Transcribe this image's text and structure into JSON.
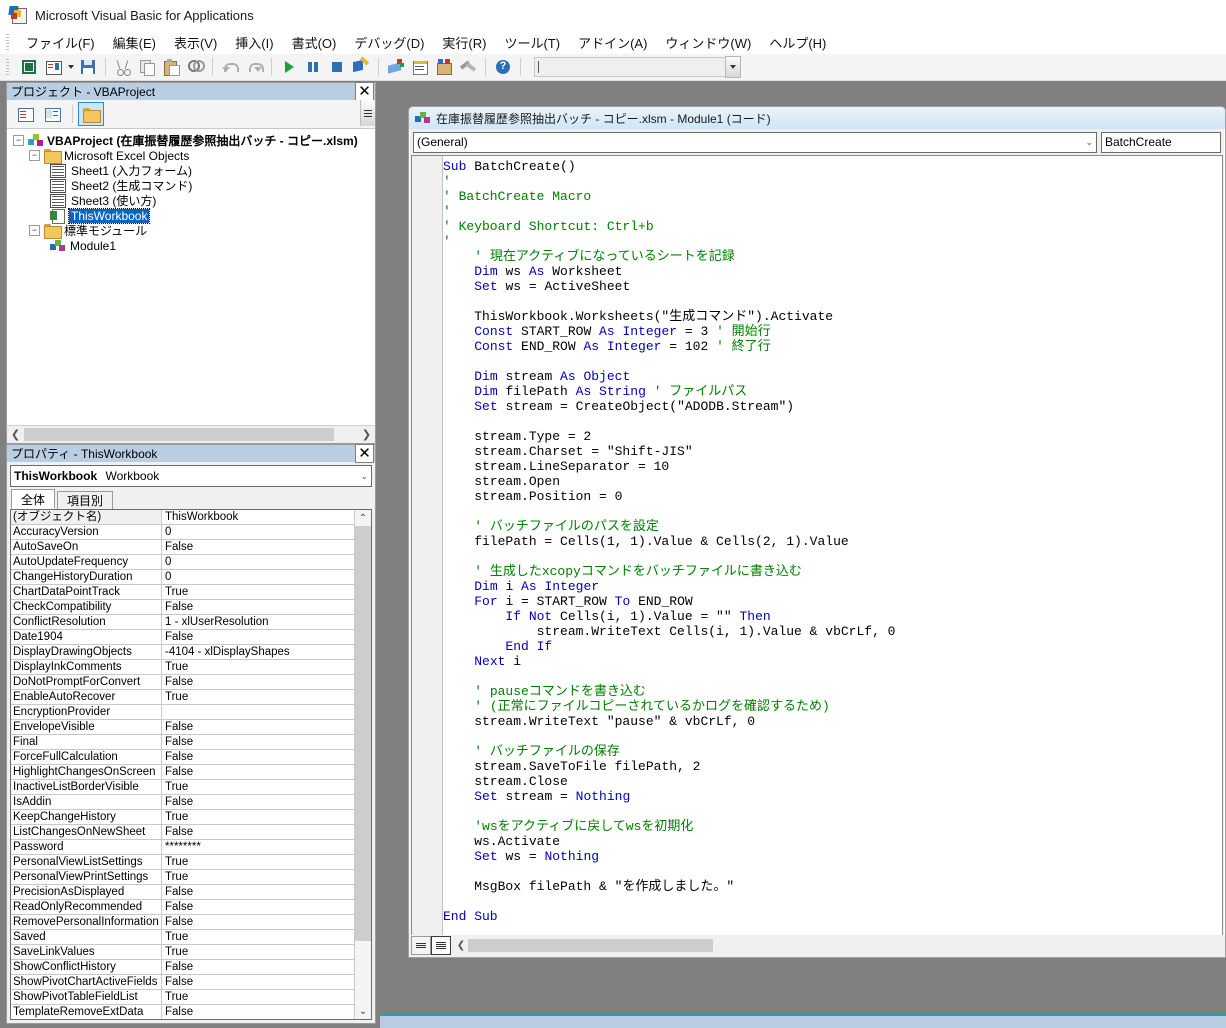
{
  "window": {
    "title": "Microsoft Visual Basic for Applications",
    "app_icon": "vba-icon"
  },
  "menubar": {
    "items": [
      {
        "label": "ファイル(F)",
        "name": "file"
      },
      {
        "label": "編集(E)",
        "name": "edit"
      },
      {
        "label": "表示(V)",
        "name": "view"
      },
      {
        "label": "挿入(I)",
        "name": "insert"
      },
      {
        "label": "書式(O)",
        "name": "format"
      },
      {
        "label": "デバッグ(D)",
        "name": "debug"
      },
      {
        "label": "実行(R)",
        "name": "run"
      },
      {
        "label": "ツール(T)",
        "name": "tools"
      },
      {
        "label": "アドイン(A)",
        "name": "addins"
      },
      {
        "label": "ウィンドウ(W)",
        "name": "window"
      },
      {
        "label": "ヘルプ(H)",
        "name": "help"
      }
    ]
  },
  "toolbar": {
    "buttons": [
      "view-excel-icon",
      "insert-userform-icon",
      "insert-dropdown-icon",
      "save-icon",
      "cut-icon",
      "copy-icon",
      "paste-icon",
      "find-icon",
      "undo-icon",
      "redo-icon",
      "run-icon",
      "break-icon",
      "reset-icon",
      "design-mode-icon",
      "project-explorer-icon",
      "properties-window-icon",
      "object-browser-icon",
      "toolbox-icon",
      "help-icon"
    ],
    "combo_value": "",
    "combo_placeholder": ""
  },
  "project_explorer": {
    "title": "プロジェクト - VBAProject",
    "close_label": "✕",
    "toolbar": [
      {
        "name": "view-code-icon",
        "pressed": false
      },
      {
        "name": "view-object-icon",
        "pressed": false
      },
      {
        "name": "toggle-folders-icon",
        "pressed": true
      }
    ],
    "tree": [
      {
        "label": "VBAProject (在庫振替履歴参照抽出バッチ - コピー.xlsm)",
        "indent": 0,
        "icon": "project-icon",
        "expander": "-",
        "bold": true,
        "selected": false
      },
      {
        "label": "Microsoft Excel Objects",
        "indent": 1,
        "icon": "folder-icon",
        "expander": "-",
        "bold": false,
        "selected": false
      },
      {
        "label": "Sheet1 (入力フォーム)",
        "indent": 2,
        "icon": "sheet-icon",
        "expander": "",
        "bold": false,
        "selected": false
      },
      {
        "label": "Sheet2 (生成コマンド)",
        "indent": 2,
        "icon": "sheet-icon",
        "expander": "",
        "bold": false,
        "selected": false
      },
      {
        "label": "Sheet3 (使い方)",
        "indent": 2,
        "icon": "sheet-icon",
        "expander": "",
        "bold": false,
        "selected": false
      },
      {
        "label": "ThisWorkbook",
        "indent": 2,
        "icon": "workbook-icon",
        "expander": "",
        "bold": false,
        "selected": true
      },
      {
        "label": "標準モジュール",
        "indent": 1,
        "icon": "folder-icon",
        "expander": "-",
        "bold": false,
        "selected": false
      },
      {
        "label": "Module1",
        "indent": 2,
        "icon": "module-icon",
        "expander": "",
        "bold": false,
        "selected": false
      }
    ]
  },
  "properties_panel": {
    "title": "プロパティ - ThisWorkbook",
    "close_label": "✕",
    "object_name": "ThisWorkbook",
    "object_type": "Workbook",
    "tabs": [
      {
        "label": "全体",
        "active": true
      },
      {
        "label": "項目別",
        "active": false
      }
    ],
    "rows": [
      {
        "key": "(オブジェクト名)",
        "value": "ThisWorkbook"
      },
      {
        "key": "AccuracyVersion",
        "value": "0"
      },
      {
        "key": "AutoSaveOn",
        "value": "False"
      },
      {
        "key": "AutoUpdateFrequency",
        "value": "0"
      },
      {
        "key": "ChangeHistoryDuration",
        "value": "0"
      },
      {
        "key": "ChartDataPointTrack",
        "value": "True"
      },
      {
        "key": "CheckCompatibility",
        "value": "False"
      },
      {
        "key": "ConflictResolution",
        "value": "1 - xlUserResolution"
      },
      {
        "key": "Date1904",
        "value": "False"
      },
      {
        "key": "DisplayDrawingObjects",
        "value": "-4104 - xlDisplayShapes"
      },
      {
        "key": "DisplayInkComments",
        "value": "True"
      },
      {
        "key": "DoNotPromptForConvert",
        "value": "False"
      },
      {
        "key": "EnableAutoRecover",
        "value": "True"
      },
      {
        "key": "EncryptionProvider",
        "value": ""
      },
      {
        "key": "EnvelopeVisible",
        "value": "False"
      },
      {
        "key": "Final",
        "value": "False"
      },
      {
        "key": "ForceFullCalculation",
        "value": "False"
      },
      {
        "key": "HighlightChangesOnScreen",
        "value": "False"
      },
      {
        "key": "InactiveListBorderVisible",
        "value": "True"
      },
      {
        "key": "IsAddin",
        "value": "False"
      },
      {
        "key": "KeepChangeHistory",
        "value": "True"
      },
      {
        "key": "ListChangesOnNewSheet",
        "value": "False"
      },
      {
        "key": "Password",
        "value": "********"
      },
      {
        "key": "PersonalViewListSettings",
        "value": "True"
      },
      {
        "key": "PersonalViewPrintSettings",
        "value": "True"
      },
      {
        "key": "PrecisionAsDisplayed",
        "value": "False"
      },
      {
        "key": "ReadOnlyRecommended",
        "value": "False"
      },
      {
        "key": "RemovePersonalInformation",
        "value": "False"
      },
      {
        "key": "Saved",
        "value": "True"
      },
      {
        "key": "SaveLinkValues",
        "value": "True"
      },
      {
        "key": "ShowConflictHistory",
        "value": "False"
      },
      {
        "key": "ShowPivotChartActiveFields",
        "value": "False"
      },
      {
        "key": "ShowPivotTableFieldList",
        "value": "True"
      },
      {
        "key": "TemplateRemoveExtData",
        "value": "False"
      }
    ]
  },
  "code_window": {
    "title": "在庫振替履歴参照抽出バッチ - コピー.xlsm - Module1 (コード)",
    "object_combo": "(General)",
    "procedure_combo": "BatchCreate",
    "view_buttons": [
      {
        "name": "procedure-view-button",
        "active": false
      },
      {
        "name": "full-module-view-button",
        "active": true
      }
    ],
    "code_lines": [
      [
        {
          "t": "Sub ",
          "c": "kw"
        },
        {
          "t": "BatchCreate()",
          "c": "tx"
        }
      ],
      [
        {
          "t": "'",
          "c": "cm"
        }
      ],
      [
        {
          "t": "' BatchCreate Macro",
          "c": "cm"
        }
      ],
      [
        {
          "t": "'",
          "c": "cm"
        }
      ],
      [
        {
          "t": "' Keyboard Shortcut: Ctrl+b",
          "c": "cm"
        }
      ],
      [
        {
          "t": "'",
          "c": "cm"
        }
      ],
      [
        {
          "t": "    ",
          "c": "tx"
        },
        {
          "t": "' 現在アクティブになっているシートを記録",
          "c": "cm"
        }
      ],
      [
        {
          "t": "    ",
          "c": "tx"
        },
        {
          "t": "Dim ",
          "c": "kw"
        },
        {
          "t": "ws ",
          "c": "tx"
        },
        {
          "t": "As ",
          "c": "kw"
        },
        {
          "t": "Worksheet",
          "c": "tx"
        }
      ],
      [
        {
          "t": "    ",
          "c": "tx"
        },
        {
          "t": "Set ",
          "c": "kw"
        },
        {
          "t": "ws = ActiveSheet",
          "c": "tx"
        }
      ],
      [
        {
          "t": "",
          "c": "tx"
        }
      ],
      [
        {
          "t": "    ThisWorkbook.Worksheets(\"生成コマンド\").Activate",
          "c": "tx"
        }
      ],
      [
        {
          "t": "    ",
          "c": "tx"
        },
        {
          "t": "Const ",
          "c": "kw"
        },
        {
          "t": "START_ROW ",
          "c": "tx"
        },
        {
          "t": "As Integer",
          "c": "kw"
        },
        {
          "t": " = 3 ",
          "c": "tx"
        },
        {
          "t": "' 開始行",
          "c": "cm"
        }
      ],
      [
        {
          "t": "    ",
          "c": "tx"
        },
        {
          "t": "Const ",
          "c": "kw"
        },
        {
          "t": "END_ROW ",
          "c": "tx"
        },
        {
          "t": "As Integer",
          "c": "kw"
        },
        {
          "t": " = 102 ",
          "c": "tx"
        },
        {
          "t": "' 終了行",
          "c": "cm"
        }
      ],
      [
        {
          "t": "",
          "c": "tx"
        }
      ],
      [
        {
          "t": "    ",
          "c": "tx"
        },
        {
          "t": "Dim ",
          "c": "kw"
        },
        {
          "t": "stream ",
          "c": "tx"
        },
        {
          "t": "As Object",
          "c": "kw"
        }
      ],
      [
        {
          "t": "    ",
          "c": "tx"
        },
        {
          "t": "Dim ",
          "c": "kw"
        },
        {
          "t": "filePath ",
          "c": "tx"
        },
        {
          "t": "As String",
          "c": "kw"
        },
        {
          "t": " ",
          "c": "tx"
        },
        {
          "t": "' ファイルパス",
          "c": "cm"
        }
      ],
      [
        {
          "t": "    ",
          "c": "tx"
        },
        {
          "t": "Set ",
          "c": "kw"
        },
        {
          "t": "stream = CreateObject(\"ADODB.Stream\")",
          "c": "tx"
        }
      ],
      [
        {
          "t": "",
          "c": "tx"
        }
      ],
      [
        {
          "t": "    stream.Type = 2",
          "c": "tx"
        }
      ],
      [
        {
          "t": "    stream.Charset = \"Shift-JIS\"",
          "c": "tx"
        }
      ],
      [
        {
          "t": "    stream.LineSeparator = 10",
          "c": "tx"
        }
      ],
      [
        {
          "t": "    stream.Open",
          "c": "tx"
        }
      ],
      [
        {
          "t": "    stream.Position = 0",
          "c": "tx"
        }
      ],
      [
        {
          "t": "",
          "c": "tx"
        }
      ],
      [
        {
          "t": "    ",
          "c": "tx"
        },
        {
          "t": "' バッチファイルのパスを設定",
          "c": "cm"
        }
      ],
      [
        {
          "t": "    filePath = Cells(1, 1).Value & Cells(2, 1).Value",
          "c": "tx"
        }
      ],
      [
        {
          "t": "",
          "c": "tx"
        }
      ],
      [
        {
          "t": "    ",
          "c": "tx"
        },
        {
          "t": "' 生成したxcopyコマンドをバッチファイルに書き込む",
          "c": "cm"
        }
      ],
      [
        {
          "t": "    ",
          "c": "tx"
        },
        {
          "t": "Dim ",
          "c": "kw"
        },
        {
          "t": "i ",
          "c": "tx"
        },
        {
          "t": "As Integer",
          "c": "kw"
        }
      ],
      [
        {
          "t": "    ",
          "c": "tx"
        },
        {
          "t": "For ",
          "c": "kw"
        },
        {
          "t": "i = START_ROW ",
          "c": "tx"
        },
        {
          "t": "To ",
          "c": "kw"
        },
        {
          "t": "END_ROW",
          "c": "tx"
        }
      ],
      [
        {
          "t": "        ",
          "c": "tx"
        },
        {
          "t": "If Not ",
          "c": "kw"
        },
        {
          "t": "Cells(i, 1).Value = \"\" ",
          "c": "tx"
        },
        {
          "t": "Then",
          "c": "kw"
        }
      ],
      [
        {
          "t": "            stream.WriteText Cells(i, 1).Value & vbCrLf, 0",
          "c": "tx"
        }
      ],
      [
        {
          "t": "        ",
          "c": "tx"
        },
        {
          "t": "End If",
          "c": "kw"
        }
      ],
      [
        {
          "t": "    ",
          "c": "tx"
        },
        {
          "t": "Next ",
          "c": "kw"
        },
        {
          "t": "i",
          "c": "tx"
        }
      ],
      [
        {
          "t": "",
          "c": "tx"
        }
      ],
      [
        {
          "t": "    ",
          "c": "tx"
        },
        {
          "t": "' pauseコマンドを書き込む",
          "c": "cm"
        }
      ],
      [
        {
          "t": "    ",
          "c": "tx"
        },
        {
          "t": "' (正常にファイルコピーされているかログを確認するため)",
          "c": "cm"
        }
      ],
      [
        {
          "t": "    stream.WriteText \"pause\" & vbCrLf, 0",
          "c": "tx"
        }
      ],
      [
        {
          "t": "",
          "c": "tx"
        }
      ],
      [
        {
          "t": "    ",
          "c": "tx"
        },
        {
          "t": "' バッチファイルの保存",
          "c": "cm"
        }
      ],
      [
        {
          "t": "    stream.SaveToFile filePath, 2",
          "c": "tx"
        }
      ],
      [
        {
          "t": "    stream.Close",
          "c": "tx"
        }
      ],
      [
        {
          "t": "    ",
          "c": "tx"
        },
        {
          "t": "Set ",
          "c": "kw"
        },
        {
          "t": "stream = ",
          "c": "tx"
        },
        {
          "t": "Nothing",
          "c": "kw"
        }
      ],
      [
        {
          "t": "",
          "c": "tx"
        }
      ],
      [
        {
          "t": "    ",
          "c": "tx"
        },
        {
          "t": "'wsをアクティブに戻してwsを初期化",
          "c": "cm"
        }
      ],
      [
        {
          "t": "    ws.Activate",
          "c": "tx"
        }
      ],
      [
        {
          "t": "    ",
          "c": "tx"
        },
        {
          "t": "Set ",
          "c": "kw"
        },
        {
          "t": "ws = ",
          "c": "tx"
        },
        {
          "t": "Nothing",
          "c": "kw"
        }
      ],
      [
        {
          "t": "",
          "c": "tx"
        }
      ],
      [
        {
          "t": "    MsgBox filePath & \"を作成しました。\"",
          "c": "tx"
        }
      ],
      [
        {
          "t": "",
          "c": "tx"
        }
      ],
      [
        {
          "t": "End Sub",
          "c": "kw"
        }
      ]
    ]
  },
  "colors": {
    "keyword": "#0000C0",
    "comment": "#008000",
    "text": "#000000",
    "selection": "#0A64C8",
    "panel_title": "#B9CDE3",
    "mdi_background": "#808080"
  }
}
